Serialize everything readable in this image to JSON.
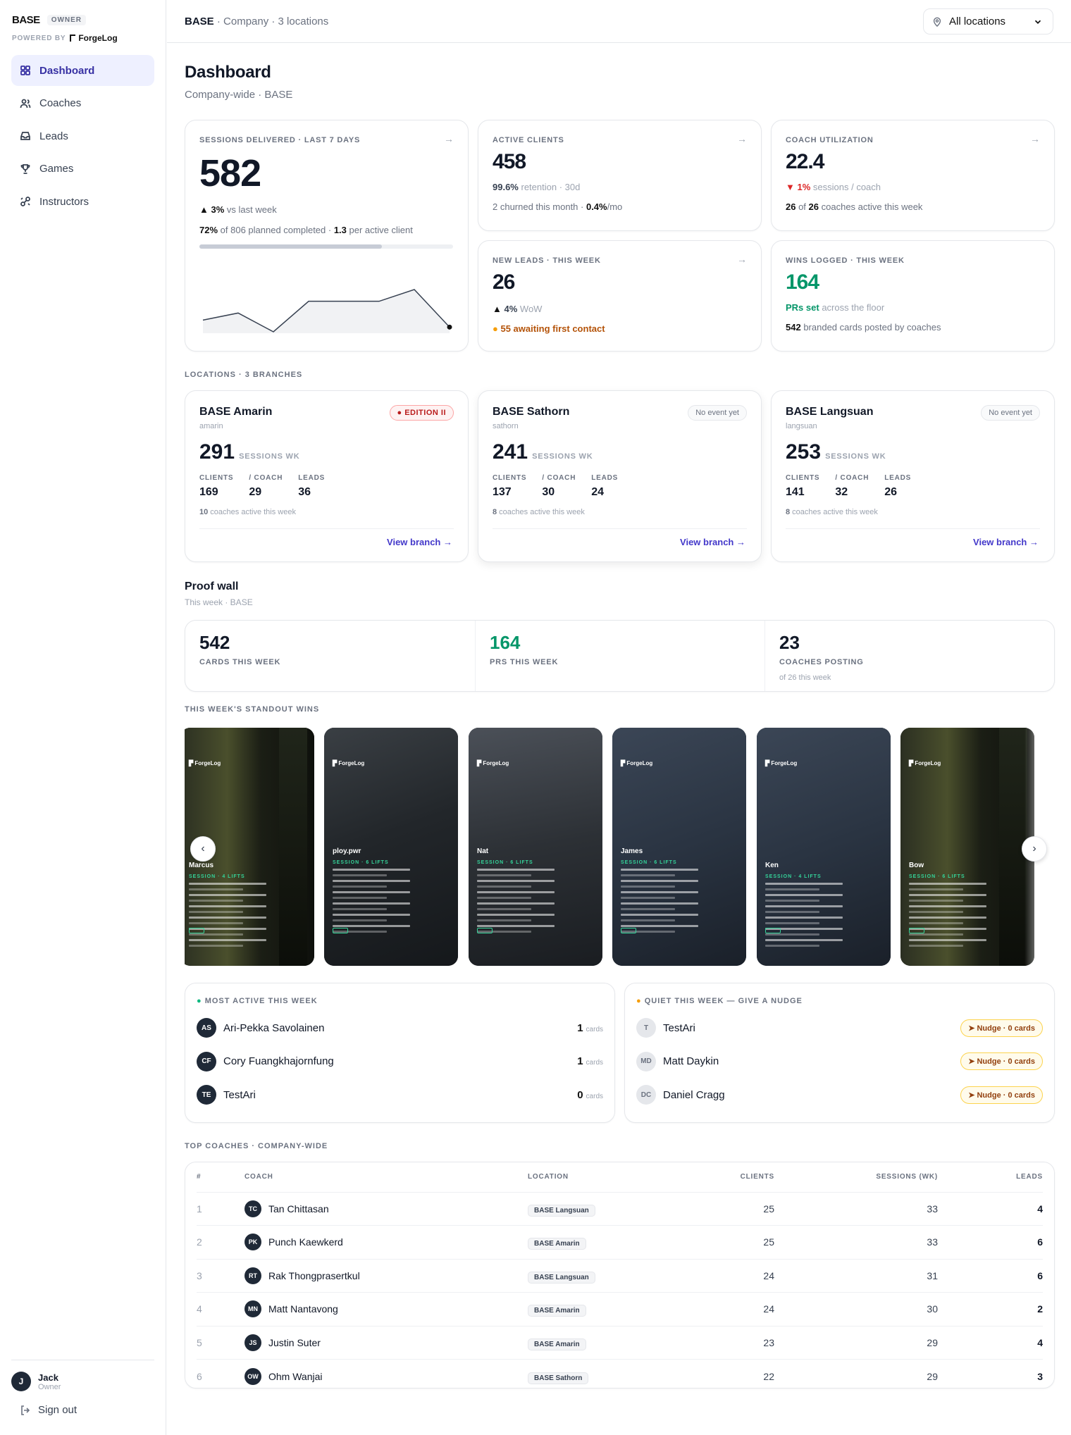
{
  "brand": {
    "name": "BASE",
    "role_badge": "OWNER",
    "powered_by": "POWERED BY",
    "powered_name": "ForgeLog"
  },
  "nav": [
    {
      "label": "Dashboard",
      "icon": "grid-icon",
      "active": true
    },
    {
      "label": "Coaches",
      "icon": "users-icon"
    },
    {
      "label": "Leads",
      "icon": "inbox-icon"
    },
    {
      "label": "Games",
      "icon": "trophy-icon"
    },
    {
      "label": "Instructors",
      "icon": "link-icon"
    }
  ],
  "user": {
    "initial": "J",
    "name": "Jack",
    "role": "Owner",
    "signout": "Sign out"
  },
  "topbar": {
    "company": "BASE",
    "crumb_rest": " · Company · 3 locations",
    "location_select": "All locations"
  },
  "page": {
    "title": "Dashboard",
    "subtitle": "Company-wide · BASE"
  },
  "kpis": {
    "sessions": {
      "label": "SESSIONS DELIVERED · LAST 7 DAYS",
      "value": "582",
      "delta": "3%",
      "delta_text": "vs last week",
      "completed_pct": "72%",
      "completed_rest": "of 806 planned completed · ",
      "per_client": "1.3",
      "per_client_rest": "per active client",
      "progress": 0.72,
      "spark": [
        23,
        26,
        18,
        31,
        31,
        31,
        36,
        20
      ]
    },
    "active": {
      "label": "ACTIVE CLIENTS",
      "value": "458",
      "retention_pct": "99.6%",
      "retention_rest": "retention · 30d",
      "churn": "2 churned this month · ",
      "churn_rate": "0.4%",
      "churn_unit": "/mo"
    },
    "util": {
      "label": "COACH UTILIZATION",
      "value": "22.4",
      "delta": "1%",
      "delta_text": "sessions / coach",
      "active_a": "26",
      "active_of": " of ",
      "active_b": "26",
      "active_rest": " coaches active this week"
    },
    "leads": {
      "label": "NEW LEADS · THIS WEEK",
      "value": "26",
      "delta": "4%",
      "delta_text": "WoW",
      "awaiting": "55 awaiting first contact"
    },
    "wins": {
      "label": "WINS LOGGED · THIS WEEK",
      "value": "164",
      "prs": "PRs set",
      "prs_rest": "across the floor",
      "cards": "542",
      "cards_rest": "branded cards posted by coaches"
    }
  },
  "locations_label": "LOCATIONS · 3 BRANCHES",
  "branches": [
    {
      "name": "BASE Amarin",
      "slug": "amarin",
      "badge": "EDITION II",
      "badge_type": "red",
      "sessions": "291",
      "unit": "SESSIONS WK",
      "clients": "169",
      "per_coach": "29",
      "leads": "36",
      "active_n": "10",
      "active_rest": " coaches active this week",
      "link": "View branch"
    },
    {
      "name": "BASE Sathorn",
      "slug": "sathorn",
      "badge": "No event yet",
      "badge_type": "gray",
      "sessions": "241",
      "unit": "SESSIONS WK",
      "clients": "137",
      "per_coach": "30",
      "leads": "24",
      "active_n": "8",
      "active_rest": " coaches active this week",
      "link": "View branch"
    },
    {
      "name": "BASE Langsuan",
      "slug": "langsuan",
      "badge": "No event yet",
      "badge_type": "gray",
      "sessions": "253",
      "unit": "SESSIONS WK",
      "clients": "141",
      "per_coach": "32",
      "leads": "26",
      "active_n": "8",
      "active_rest": " coaches active this week",
      "link": "View branch"
    }
  ],
  "branch_stat_labels": {
    "clients": "CLIENTS",
    "per_coach": "/ COACH",
    "leads": "LEADS"
  },
  "proof": {
    "title": "Proof wall",
    "subtitle": "This week · BASE",
    "cards": {
      "value": "542",
      "label": "CARDS THIS WEEK"
    },
    "prs": {
      "value": "164",
      "label": "PRS THIS WEEK"
    },
    "coaches": {
      "value": "23",
      "label": "COACHES POSTING",
      "sub": "of 26 this week"
    }
  },
  "standout_label": "THIS WEEK'S STANDOUT WINS",
  "wins_cards": [
    {
      "name": "Marcus",
      "session": "SESSION · 4 LIFTS",
      "logo": "ForgeLog",
      "theme": "gym"
    },
    {
      "name": "ploy.pwr",
      "session": "SESSION · 6 LIFTS",
      "logo": "ForgeLog",
      "theme": "dark"
    },
    {
      "name": "Nat",
      "session": "SESSION · 6 LIFTS",
      "logo": "ForgeLog",
      "theme": "mid"
    },
    {
      "name": "James",
      "session": "SESSION · 6 LIFTS",
      "logo": "ForgeLog",
      "theme": "blue"
    },
    {
      "name": "Ken",
      "session": "SESSION · 4 LIFTS",
      "logo": "ForgeLog",
      "theme": "blue"
    },
    {
      "name": "Bow",
      "session": "SESSION · 6 LIFTS",
      "logo": "ForgeLog",
      "theme": "gym"
    }
  ],
  "most_active": {
    "label": "MOST ACTIVE THIS WEEK",
    "unit": "cards",
    "rows": [
      {
        "initials": "AS",
        "name": "Ari-Pekka Savolainen",
        "count": "1"
      },
      {
        "initials": "CF",
        "name": "Cory Fuangkhajornfung",
        "count": "1"
      },
      {
        "initials": "TE",
        "name": "TestAri",
        "count": "0"
      }
    ]
  },
  "quiet": {
    "label": "QUIET THIS WEEK — GIVE A NUDGE",
    "rows": [
      {
        "initials": "T",
        "name": "TestAri",
        "nudge": "Nudge · 0 cards"
      },
      {
        "initials": "MD",
        "name": "Matt Daykin",
        "nudge": "Nudge · 0 cards"
      },
      {
        "initials": "DC",
        "name": "Daniel Cragg",
        "nudge": "Nudge · 0 cards"
      }
    ]
  },
  "top_coaches": {
    "label": "TOP COACHES · COMPANY-WIDE",
    "headers": [
      "#",
      "COACH",
      "LOCATION",
      "CLIENTS",
      "SESSIONS (WK)",
      "LEADS"
    ],
    "rows": [
      {
        "rank": "1",
        "initials": "TC",
        "name": "Tan Chittasan",
        "location": "BASE Langsuan",
        "clients": "25",
        "sessions": "33",
        "leads": "4"
      },
      {
        "rank": "2",
        "initials": "PK",
        "name": "Punch Kaewkerd",
        "location": "BASE Amarin",
        "clients": "25",
        "sessions": "33",
        "leads": "6"
      },
      {
        "rank": "3",
        "initials": "RT",
        "name": "Rak Thongprasertkul",
        "location": "BASE Langsuan",
        "clients": "24",
        "sessions": "31",
        "leads": "6"
      },
      {
        "rank": "4",
        "initials": "MN",
        "name": "Matt Nantavong",
        "location": "BASE Amarin",
        "clients": "24",
        "sessions": "30",
        "leads": "2"
      },
      {
        "rank": "5",
        "initials": "JS",
        "name": "Justin Suter",
        "location": "BASE Amarin",
        "clients": "23",
        "sessions": "29",
        "leads": "4"
      },
      {
        "rank": "6",
        "initials": "OW",
        "name": "Ohm Wanjai",
        "location": "BASE Sathorn",
        "clients": "22",
        "sessions": "29",
        "leads": "3"
      }
    ]
  },
  "colors": {
    "accent": "#3730a3",
    "green": "#059669",
    "red": "#dc2626",
    "amber": "#d97706"
  }
}
